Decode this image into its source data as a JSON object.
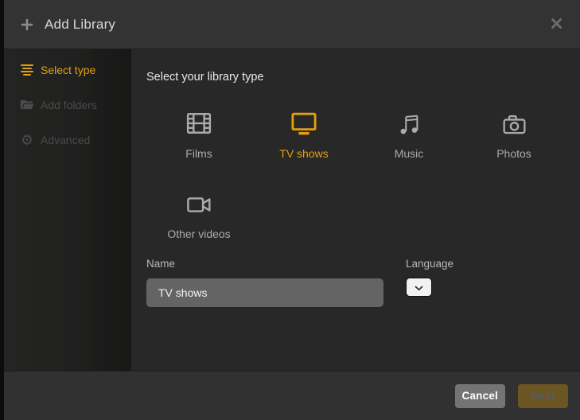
{
  "dialog": {
    "title": "Add Library"
  },
  "sidebar": {
    "items": [
      {
        "label": "Select type",
        "icon": "list-bars-icon",
        "active": true
      },
      {
        "label": "Add folders",
        "icon": "folder-icon",
        "active": false
      },
      {
        "label": "Advanced",
        "icon": "gear-icon",
        "active": false
      }
    ]
  },
  "content": {
    "heading": "Select your library type",
    "library_types": [
      {
        "label": "Films",
        "icon": "film-strip-icon",
        "selected": false
      },
      {
        "label": "TV shows",
        "icon": "tv-icon",
        "selected": true
      },
      {
        "label": "Music",
        "icon": "music-note-icon",
        "selected": false
      },
      {
        "label": "Photos",
        "icon": "camera-icon",
        "selected": false
      },
      {
        "label": "Other videos",
        "icon": "video-camera-icon",
        "selected": false
      }
    ],
    "name_field": {
      "label": "Name",
      "value": "TV shows"
    },
    "language_field": {
      "label": "Language",
      "selected_value": ""
    }
  },
  "footer": {
    "cancel_label": "Cancel",
    "next_label": "Next"
  },
  "colors": {
    "accent_gold": "#e5a00d",
    "header_bg": "#333333",
    "content_bg": "#282828",
    "sidebar_bg": "#1f1f1e",
    "footer_bg": "#313131",
    "input_bg": "#646464",
    "cancel_button_bg": "#747474",
    "next_button_bg_disabled": "#6b5523",
    "inactive_text": "#4b4b4b",
    "label_text": "#b9b9b9"
  }
}
